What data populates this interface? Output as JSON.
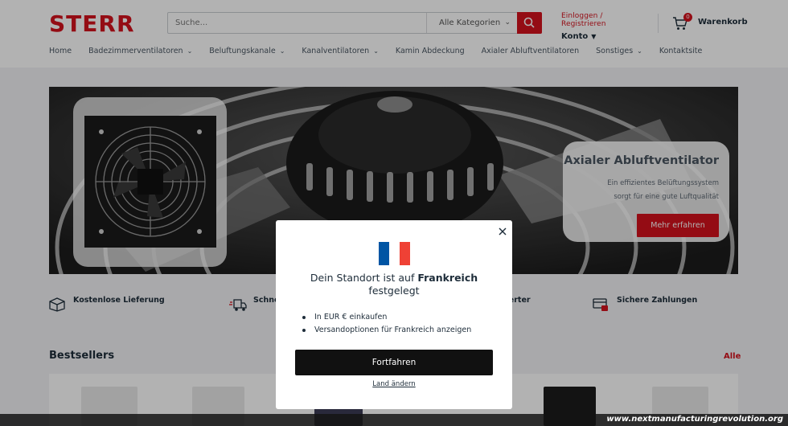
{
  "header": {
    "logo_text": "STERR",
    "search_placeholder": "Suche...",
    "search_category": "Alle Kategorien",
    "login_link": "Einloggen / Registrieren",
    "account_label": "Konto",
    "cart_count": "0",
    "cart_label": "Warenkorb",
    "brand_color": "#d4121d"
  },
  "nav": {
    "items": [
      {
        "label": "Home",
        "has_dropdown": false
      },
      {
        "label": "Badezimmerventilatoren",
        "has_dropdown": true
      },
      {
        "label": "Beluftungskanale",
        "has_dropdown": true
      },
      {
        "label": "Kanalventilatoren",
        "has_dropdown": true
      },
      {
        "label": "Kamin Abdeckung",
        "has_dropdown": false
      },
      {
        "label": "Axialer Abluftventilatoren",
        "has_dropdown": false
      },
      {
        "label": "Sonstiges",
        "has_dropdown": true
      },
      {
        "label": "Kontaktsite",
        "has_dropdown": false
      }
    ]
  },
  "hero": {
    "title": "Axialer Abluftventilator",
    "text_line1": "Ein effizientes Belüftungssystem",
    "text_line2": "sorgt für eine gute Luftqualität",
    "button_label": "Mehr erfahren"
  },
  "features": [
    {
      "label": "Kostenlose Lieferung",
      "icon": "box-icon"
    },
    {
      "label": "Schne",
      "icon": "fast-delivery-icon"
    },
    {
      "label": "tierter",
      "icon": "badge-icon"
    },
    {
      "label": "Sichere Zahlungen",
      "icon": "secure-payment-icon"
    }
  ],
  "bestsellers": {
    "title": "Bestsellers",
    "all_link": "Alle"
  },
  "modal": {
    "title_prefix": "Dein Standort ist auf",
    "country": "Frankreich",
    "title_suffix": "festgelegt",
    "bullets": [
      "In EUR € einkaufen",
      "Versandoptionen für Frankreich anzeigen"
    ],
    "continue_label": "Fortfahren",
    "change_country_label": "Land ändern",
    "flag_colors": [
      "#0055a4",
      "#ffffff",
      "#ef4135"
    ]
  },
  "watermark": "www.nextmanufacturingrevolution.org"
}
